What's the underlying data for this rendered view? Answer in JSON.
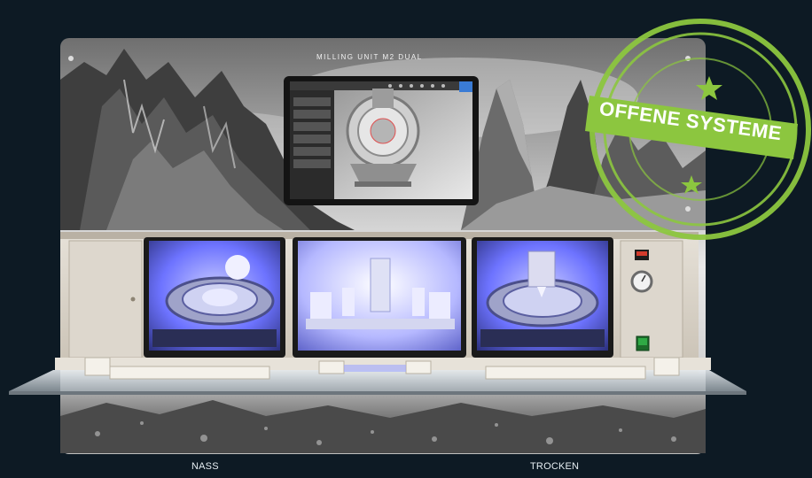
{
  "product": {
    "header_text": "MILLING UNIT M2 DUAL",
    "labels": {
      "left": "NASS",
      "right": "TROCKEN"
    }
  },
  "stamp": {
    "text": "OFFENE SYSTEME",
    "color": "#8cc63f"
  },
  "colors": {
    "background": "#0d1a24",
    "glow": "#6d73ff",
    "cabinet": "#d8d2c8"
  },
  "icons": [
    "machine-illustration",
    "stamp-badge",
    "monitor-screen",
    "pressure-gauge-icon",
    "power-switch-icon"
  ]
}
